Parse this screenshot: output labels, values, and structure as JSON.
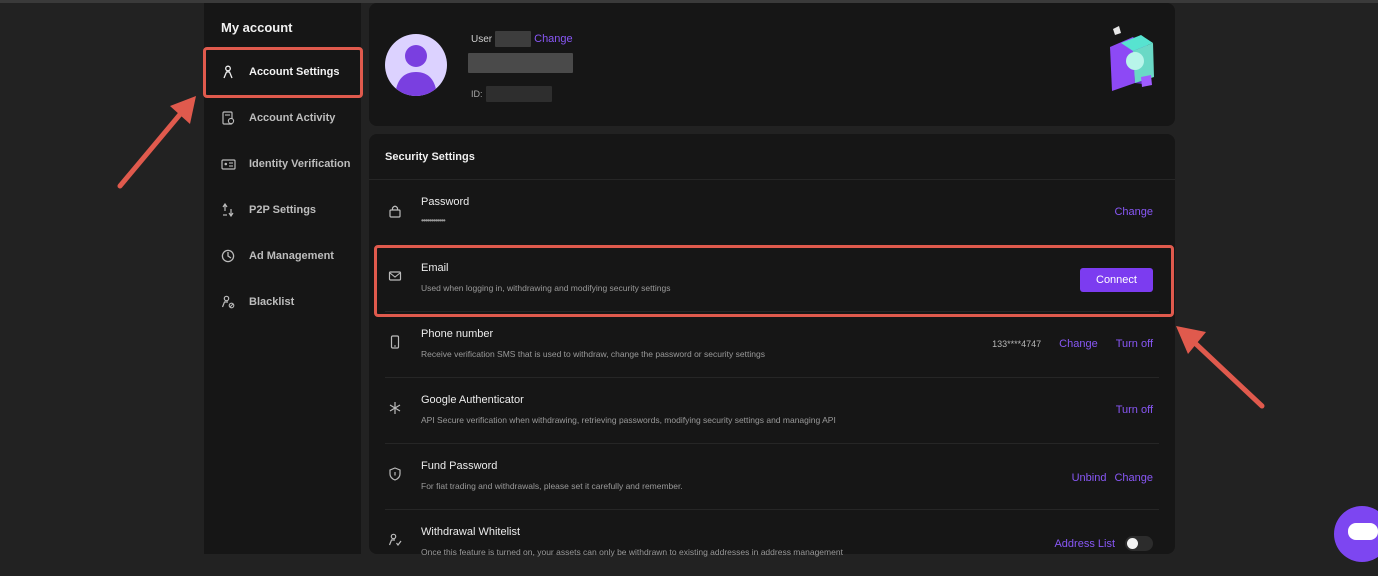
{
  "sidebar": {
    "title": "My account",
    "items": [
      {
        "label": "Account Settings",
        "icon": "person-icon",
        "active": true
      },
      {
        "label": "Account Activity",
        "icon": "activity-log-icon"
      },
      {
        "label": "Identity Verification",
        "icon": "id-card-icon"
      },
      {
        "label": "P2P Settings",
        "icon": "p2p-icon"
      },
      {
        "label": "Ad Management",
        "icon": "pie-clock-icon"
      },
      {
        "label": "Blacklist",
        "icon": "user-block-icon"
      }
    ]
  },
  "profile": {
    "user_prefix": "User",
    "change_link": "Change",
    "id_prefix": "ID:"
  },
  "security": {
    "title": "Security Settings",
    "rows": [
      {
        "name": "Password",
        "desc": "••••••••••••",
        "icon": "lock-icon",
        "actions": [
          "Change"
        ]
      },
      {
        "name": "Email",
        "desc": "Used when logging in, withdrawing and modifying security settings",
        "icon": "mail-icon",
        "button": "Connect"
      },
      {
        "name": "Phone number",
        "desc": "Receive verification SMS that is used to withdraw, change the password or security settings",
        "icon": "phone-icon",
        "value": "133****4747",
        "actions": [
          "Change",
          "Turn off"
        ]
      },
      {
        "name": "Google Authenticator",
        "desc": "API Secure verification when withdrawing, retrieving passwords, modifying security settings and managing API",
        "icon": "authenticator-icon",
        "actions": [
          "Turn off"
        ]
      },
      {
        "name": "Fund Password",
        "desc": "For fiat trading and withdrawals, please set it carefully and remember.",
        "icon": "shield-icon",
        "actions": [
          "Unbind",
          "Change"
        ]
      },
      {
        "name": "Withdrawal Whitelist",
        "desc": "Once this feature is turned on, your assets can only be withdrawn to existing addresses in address management",
        "icon": "user-check-icon",
        "actions": [
          "Address List"
        ],
        "toggle": "off"
      }
    ]
  },
  "colors": {
    "accent": "#7c3cf0",
    "link": "#8857f5",
    "highlight": "#e05a4d",
    "background": "#222222",
    "panel": "#161616"
  }
}
